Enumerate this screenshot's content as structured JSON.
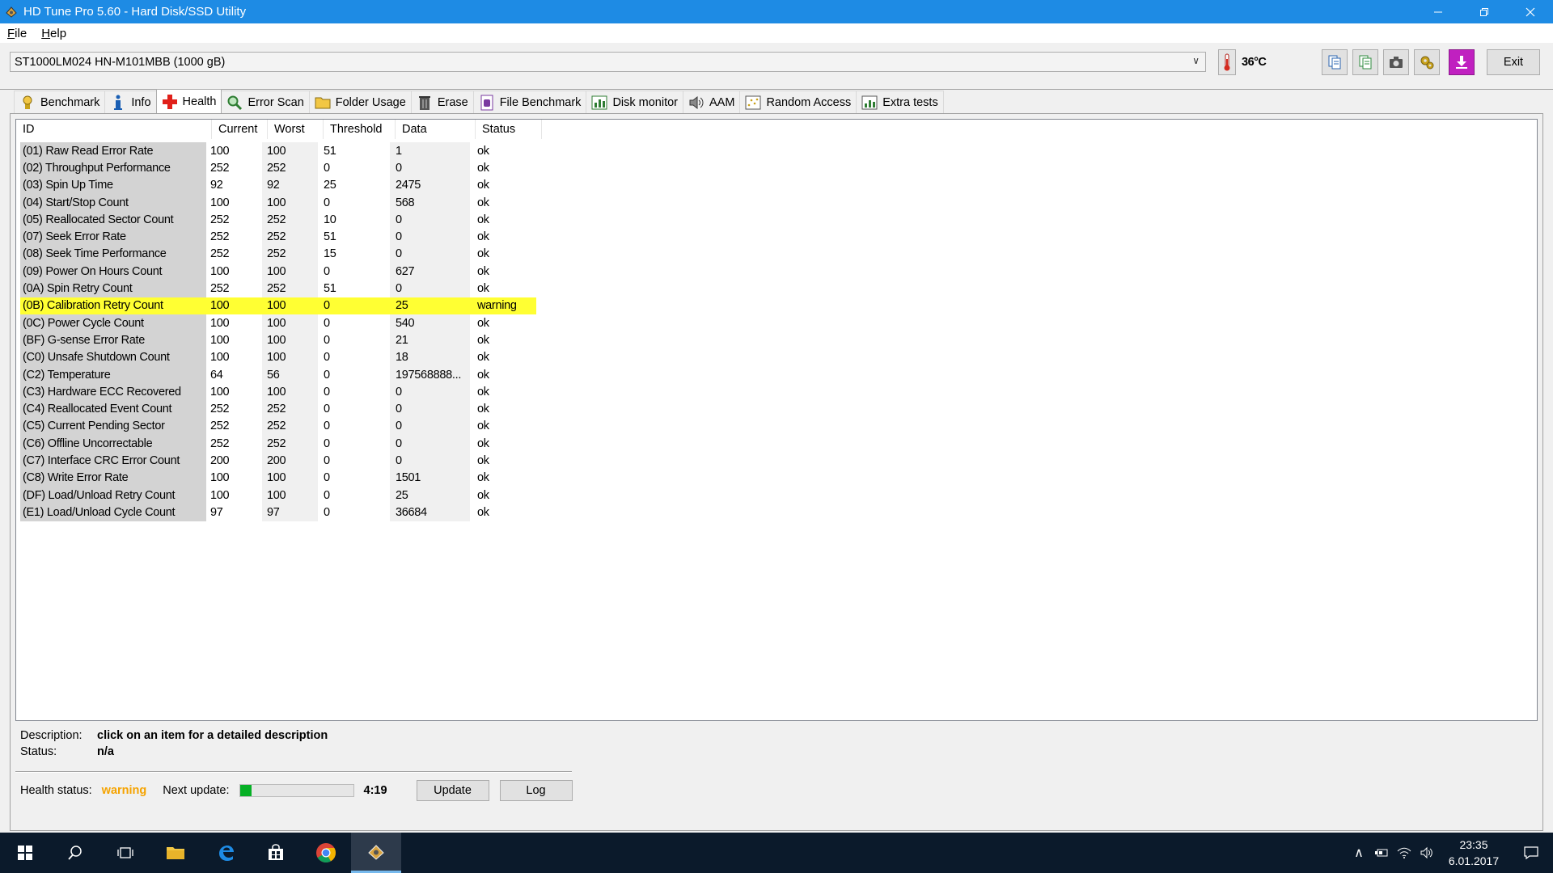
{
  "window": {
    "title": "HD Tune Pro 5.60 - Hard Disk/SSD Utility"
  },
  "menu": [
    {
      "mnemonic": "F",
      "rest": "ile"
    },
    {
      "mnemonic": "H",
      "rest": "elp"
    }
  ],
  "toolbar": {
    "drive": "ST1000LM024 HN-M101MBB (1000 gB)",
    "temperature": "36°C",
    "exit_label": "Exit"
  },
  "tabs": [
    {
      "label": "Benchmark",
      "icon": "benchmark-icon",
      "active": false
    },
    {
      "label": "Info",
      "icon": "info-icon",
      "active": false
    },
    {
      "label": "Health",
      "icon": "health-cross-icon",
      "active": true
    },
    {
      "label": "Error Scan",
      "icon": "magnifier-icon",
      "active": false
    },
    {
      "label": "Folder Usage",
      "icon": "folder-icon",
      "active": false
    },
    {
      "label": "Erase",
      "icon": "trash-icon",
      "active": false
    },
    {
      "label": "File Benchmark",
      "icon": "file-benchmark-icon",
      "active": false
    },
    {
      "label": "Disk monitor",
      "icon": "disk-monitor-icon",
      "active": false
    },
    {
      "label": "AAM",
      "icon": "speaker-icon",
      "active": false
    },
    {
      "label": "Random Access",
      "icon": "random-access-icon",
      "active": false
    },
    {
      "label": "Extra tests",
      "icon": "extra-tests-icon",
      "active": false
    }
  ],
  "table": {
    "headers": [
      "ID",
      "Current",
      "Worst",
      "Threshold",
      "Data",
      "Status"
    ],
    "rows": [
      [
        "(01) Raw Read Error Rate",
        "100",
        "100",
        "51",
        "1",
        "ok"
      ],
      [
        "(02) Throughput Performance",
        "252",
        "252",
        "0",
        "0",
        "ok"
      ],
      [
        "(03) Spin Up Time",
        "92",
        "92",
        "25",
        "2475",
        "ok"
      ],
      [
        "(04) Start/Stop Count",
        "100",
        "100",
        "0",
        "568",
        "ok"
      ],
      [
        "(05) Reallocated Sector Count",
        "252",
        "252",
        "10",
        "0",
        "ok"
      ],
      [
        "(07) Seek Error Rate",
        "252",
        "252",
        "51",
        "0",
        "ok"
      ],
      [
        "(08) Seek Time Performance",
        "252",
        "252",
        "15",
        "0",
        "ok"
      ],
      [
        "(09) Power On Hours Count",
        "100",
        "100",
        "0",
        "627",
        "ok"
      ],
      [
        "(0A) Spin Retry Count",
        "252",
        "252",
        "51",
        "0",
        "ok"
      ],
      [
        "(0B) Calibration Retry Count",
        "100",
        "100",
        "0",
        "25",
        "warning"
      ],
      [
        "(0C) Power Cycle Count",
        "100",
        "100",
        "0",
        "540",
        "ok"
      ],
      [
        "(BF) G-sense Error Rate",
        "100",
        "100",
        "0",
        "21",
        "ok"
      ],
      [
        "(C0) Unsafe Shutdown Count",
        "100",
        "100",
        "0",
        "18",
        "ok"
      ],
      [
        "(C2) Temperature",
        "64",
        "56",
        "0",
        "197568888...",
        "ok"
      ],
      [
        "(C3) Hardware ECC Recovered",
        "100",
        "100",
        "0",
        "0",
        "ok"
      ],
      [
        "(C4) Reallocated Event Count",
        "252",
        "252",
        "0",
        "0",
        "ok"
      ],
      [
        "(C5) Current Pending Sector",
        "252",
        "252",
        "0",
        "0",
        "ok"
      ],
      [
        "(C6) Offline Uncorrectable",
        "252",
        "252",
        "0",
        "0",
        "ok"
      ],
      [
        "(C7) Interface CRC Error Count",
        "200",
        "200",
        "0",
        "0",
        "ok"
      ],
      [
        "(C8) Write Error Rate",
        "100",
        "100",
        "0",
        "1501",
        "ok"
      ],
      [
        "(DF) Load/Unload Retry Count",
        "100",
        "100",
        "0",
        "25",
        "ok"
      ],
      [
        "(E1) Load/Unload Cycle Count",
        "97",
        "97",
        "0",
        "36684",
        "ok"
      ]
    ]
  },
  "description": {
    "desc_label": "Description:",
    "desc_value": "click on an item for a detailed description",
    "status_label": "Status:",
    "status_value": "n/a"
  },
  "health": {
    "status_label": "Health status:",
    "status_value": "warning",
    "next_update_label": "Next update:",
    "progress_fraction": 0.1,
    "countdown": "4:19",
    "update_label": "Update",
    "log_label": "Log"
  },
  "taskbar": {
    "time": "23:35",
    "date": "6.01.2017"
  },
  "colors": {
    "titlebar": "#1e8be4",
    "warning_row": "#ffff33",
    "warning_text": "#f5a300",
    "progress": "#06b025",
    "taskbar": "#0b1a2b"
  }
}
